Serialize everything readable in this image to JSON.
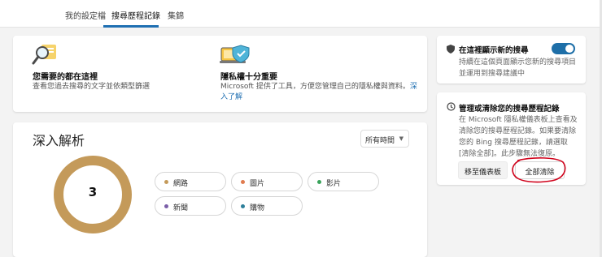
{
  "tabs": [
    {
      "label": "我的設定檔"
    },
    {
      "label": "搜尋歷程記錄"
    },
    {
      "label": "集錦"
    }
  ],
  "features": [
    {
      "title": "您需要的都在這裡",
      "desc": "查看您過去搜尋的文字並依類型篩選",
      "icon": "search-magnifier-icon"
    },
    {
      "title": "隱私權十分重要",
      "desc_prefix": "Microsoft 提供了工具，方便您管理自己的隱私權與資料。",
      "link": "深入了解",
      "icon": "privacy-shield-laptop-icon"
    }
  ],
  "insights": {
    "title": "深入解析",
    "time_filter": "所有時間",
    "total": "3",
    "categories": [
      {
        "label": "網路",
        "color": "#c49a5a"
      },
      {
        "label": "圖片",
        "color": "#e07b4f"
      },
      {
        "label": "影片",
        "color": "#3aa35b"
      },
      {
        "label": "新聞",
        "color": "#7a5ea8"
      },
      {
        "label": "購物",
        "color": "#2d7f9a"
      }
    ]
  },
  "show_new_searches": {
    "title": "在這裡顯示新的搜尋",
    "desc": "持續在這個頁面顯示您新的搜尋項目並運用到搜尋建議中",
    "enabled": true,
    "icon": "shield-icon"
  },
  "manage": {
    "title": "管理或清除您的搜尋歷程記錄",
    "desc": "在 Microsoft 隱私權儀表板上查看及清除您的搜尋歷程記錄。如果要清除您的 Bing 搜尋歷程記錄，請選取 [清除全部]。此步驟無法復原。",
    "dashboard_button": "移至儀表板",
    "clear_all_button": "全部清除",
    "icon": "history-icon",
    "annotation_color": "#d0021b"
  }
}
